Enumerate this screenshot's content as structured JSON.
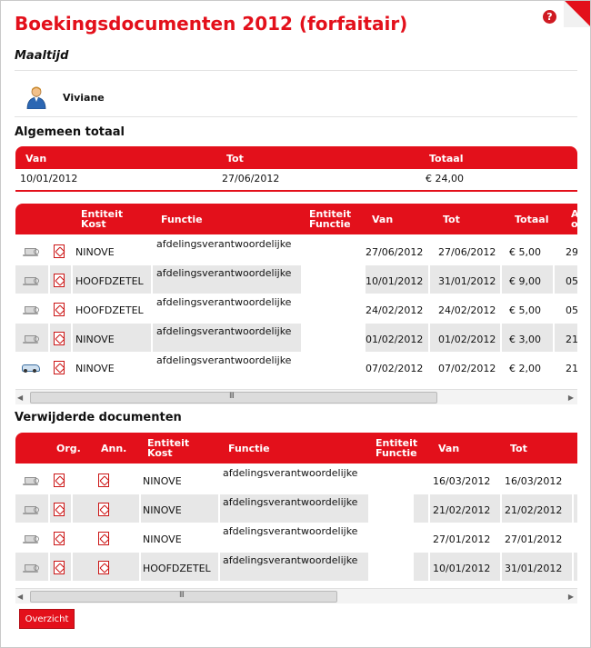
{
  "page": {
    "title": "Boekingsdocumenten 2012 (forfaitair)",
    "subtitle": "Maaltijd",
    "help_icon": "question-mark-icon",
    "user": {
      "name": "Viviane",
      "icon": "user-avatar-icon"
    }
  },
  "totals": {
    "heading": "Algemeen totaal",
    "columns": [
      "Van",
      "Tot",
      "Totaal"
    ],
    "row": {
      "van": "10/01/2012",
      "tot": "27/06/2012",
      "totaal": "€ 24,00"
    }
  },
  "documents": {
    "columns": {
      "entiteit_kost": "Entiteit\nKost",
      "functie": "Functie",
      "entiteit_functie": "Entiteit\nFunctie",
      "van": "Van",
      "tot": "Tot",
      "totaal": "Totaal",
      "cutoff": "A\no"
    },
    "rows": [
      {
        "type": "cup-icon",
        "entiteit_kost": "NINOVE",
        "functie": "afdelingsverantwoordelijke",
        "van": "27/06/2012",
        "tot": "27/06/2012",
        "totaal": "€ 5,00",
        "cutoff": "29"
      },
      {
        "type": "cup-icon",
        "entiteit_kost": "HOOFDZETEL",
        "functie": "afdelingsverantwoordelijke",
        "van": "10/01/2012",
        "tot": "31/01/2012",
        "totaal": "€ 9,00",
        "cutoff": "05"
      },
      {
        "type": "cup-icon",
        "entiteit_kost": "HOOFDZETEL",
        "functie": "afdelingsverantwoordelijke",
        "van": "24/02/2012",
        "tot": "24/02/2012",
        "totaal": "€ 5,00",
        "cutoff": "05"
      },
      {
        "type": "cup-icon",
        "entiteit_kost": "NINOVE",
        "functie": "afdelingsverantwoordelijke",
        "van": "01/02/2012",
        "tot": "01/02/2012",
        "totaal": "€ 3,00",
        "cutoff": "21"
      },
      {
        "type": "car-icon",
        "entiteit_kost": "NINOVE",
        "functie": "afdelingsverantwoordelijke",
        "van": "07/02/2012",
        "tot": "07/02/2012",
        "totaal": "€ 2,00",
        "cutoff": "21"
      }
    ],
    "scroll_grip": "III"
  },
  "deleted": {
    "heading": "Verwijderde documenten",
    "columns": {
      "org": "Org.",
      "ann": "Ann.",
      "entiteit_kost": "Entiteit\nKost",
      "functie": "Functie",
      "entiteit_functie": "Entiteit\nFunctie",
      "van": "Van",
      "tot": "Tot"
    },
    "rows": [
      {
        "entiteit_kost": "NINOVE",
        "functie": "afdelingsverantwoordelijke",
        "van": "16/03/2012",
        "tot": "16/03/2012"
      },
      {
        "entiteit_kost": "NINOVE",
        "functie": "afdelingsverantwoordelijke",
        "van": "21/02/2012",
        "tot": "21/02/2012"
      },
      {
        "entiteit_kost": "NINOVE",
        "functie": "afdelingsverantwoordelijke",
        "van": "27/01/2012",
        "tot": "27/01/2012"
      },
      {
        "entiteit_kost": "HOOFDZETEL",
        "functie": "afdelingsverantwoordelijke",
        "van": "10/01/2012",
        "tot": "31/01/2012"
      }
    ],
    "scroll_grip": "III"
  },
  "buttons": {
    "overzicht": "Overzicht"
  },
  "colors": {
    "accent": "#e3101b",
    "row_shade": "#e7e7e7"
  }
}
